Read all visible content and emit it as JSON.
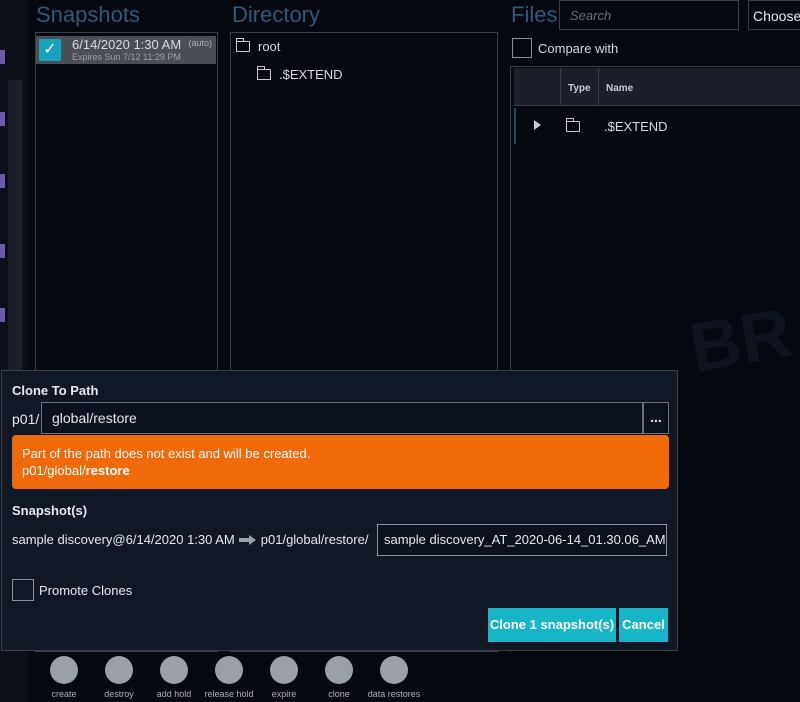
{
  "panels": {
    "snapshots_title": "Snapshots",
    "directory_title": "Directory",
    "files_title": "Files"
  },
  "snapshots": [
    {
      "date": "6/14/2020 1:30 AM",
      "tag": "(auto)",
      "expires": "Expires Sun 7/12 11:29 PM",
      "selected": true
    }
  ],
  "directory": {
    "items": [
      {
        "label": "root",
        "icon": "folder-icon"
      },
      {
        "label": ".$EXTEND",
        "icon": "folder-icon"
      }
    ]
  },
  "files": {
    "search_placeholder": "Search",
    "choose_label": "Choose",
    "compare_label": "Compare with",
    "columns": [
      "Type",
      "Name"
    ],
    "rows": [
      {
        "name": ".$EXTEND",
        "icon": "folder-icon"
      }
    ]
  },
  "toolbar": {
    "items": [
      {
        "label": "create",
        "icon": "camera-icon"
      },
      {
        "label": "destroy",
        "icon": "trash-icon"
      },
      {
        "label": "add hold",
        "icon": "pin-icon"
      },
      {
        "label": "release hold",
        "icon": "pin-off-icon"
      },
      {
        "label": "expire",
        "icon": "calendar-icon"
      },
      {
        "label": "clone",
        "icon": "copy-icon"
      },
      {
        "label": "data restores",
        "icon": "upload-icon"
      }
    ]
  },
  "modal": {
    "title": "Clone To Path",
    "path_prefix": "p01/",
    "path_value": "global/restore",
    "browse_label": "...",
    "warning_line1": "Part of the path does not exist and will be created.",
    "warning_path_base": "p01/global/",
    "warning_path_new": "restore",
    "snapshots_title": "Snapshot(s)",
    "snapshot_source": "sample discovery@6/14/2020 1:30 AM",
    "snapshot_target_path": "p01/global/restore/",
    "snapshot_clone_name": "sample discovery_AT_2020-06-14_01.30.06_AM",
    "promote_label": "Promote Clones",
    "clone_button": "Clone 1 snapshot(s)",
    "cancel_button": "Cancel"
  },
  "colors": {
    "accent": "#16b5c8",
    "warning": "#f06a0a",
    "title_blue": "#2d5a78"
  }
}
